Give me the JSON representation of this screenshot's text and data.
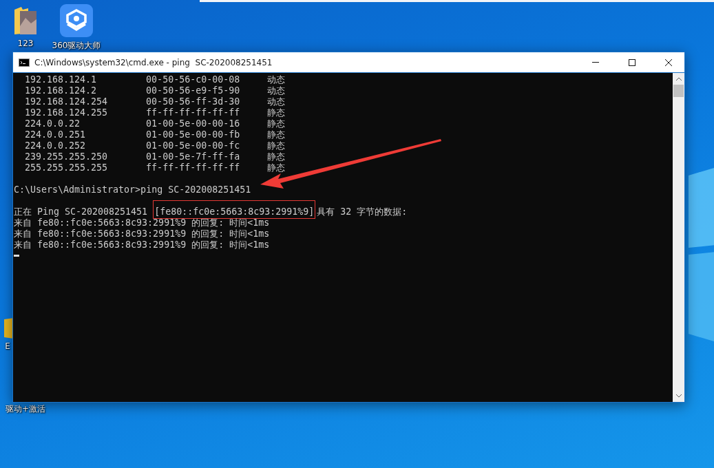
{
  "desktop_icons": [
    {
      "label": "123",
      "kind": "folder"
    },
    {
      "label": "360驱动大师",
      "kind": "app"
    },
    {
      "label": "E",
      "kind": "partial"
    },
    {
      "label": "驱动+激活",
      "kind": "stack"
    }
  ],
  "window": {
    "title": "C:\\Windows\\system32\\cmd.exe - ping  SC-202008251451"
  },
  "arp_rows": [
    {
      "address": "192.168.124.1",
      "mac": "00-50-56-c0-00-08",
      "type": "动态"
    },
    {
      "address": "192.168.124.2",
      "mac": "00-50-56-e9-f5-90",
      "type": "动态"
    },
    {
      "address": "192.168.124.254",
      "mac": "00-50-56-ff-3d-30",
      "type": "动态"
    },
    {
      "address": "192.168.124.255",
      "mac": "ff-ff-ff-ff-ff-ff",
      "type": "静态"
    },
    {
      "address": "224.0.0.22",
      "mac": "01-00-5e-00-00-16",
      "type": "静态"
    },
    {
      "address": "224.0.0.251",
      "mac": "01-00-5e-00-00-fb",
      "type": "静态"
    },
    {
      "address": "224.0.0.252",
      "mac": "01-00-5e-00-00-fc",
      "type": "静态"
    },
    {
      "address": "239.255.255.250",
      "mac": "01-00-5e-7f-ff-fa",
      "type": "静态"
    },
    {
      "address": "255.255.255.255",
      "mac": "ff-ff-ff-ff-ff-ff",
      "type": "静态"
    }
  ],
  "prompt": "C:\\Users\\Administrator>ping SC-202008251451",
  "ping_header": {
    "prefix": "正在 Ping SC-202008251451",
    "address": "[fe80::fc0e:5663:8c93:2991%9]",
    "suffix": "具有 32 字节的数据:"
  },
  "replies": [
    "来自 fe80::fc0e:5663:8c93:2991%9 的回复: 时间<1ms",
    "来自 fe80::fc0e:5663:8c93:2991%9 的回复: 时间<1ms",
    "来自 fe80::fc0e:5663:8c93:2991%9 的回复: 时间<1ms"
  ]
}
